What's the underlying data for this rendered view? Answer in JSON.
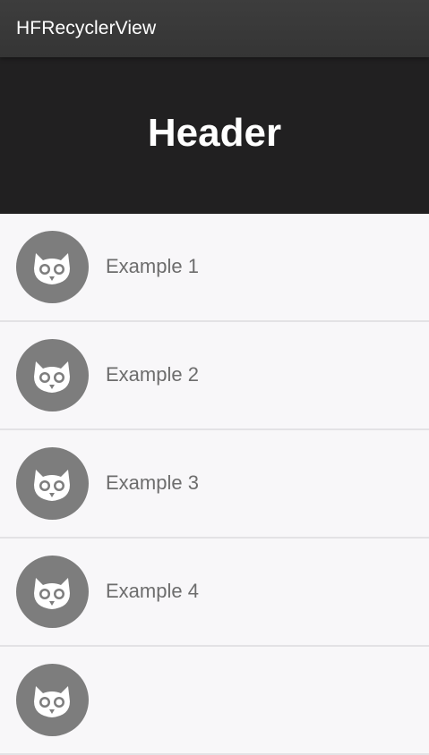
{
  "app_bar": {
    "title": "HFRecyclerView"
  },
  "header": {
    "text": "Header"
  },
  "list": {
    "items": [
      {
        "label": "Example 1",
        "icon": "owl-icon"
      },
      {
        "label": "Example 2",
        "icon": "owl-icon"
      },
      {
        "label": "Example 3",
        "icon": "owl-icon"
      },
      {
        "label": "Example 4",
        "icon": "owl-icon"
      },
      {
        "label": "",
        "icon": "owl-icon"
      }
    ]
  },
  "colors": {
    "app_bar": "#3a3a3a",
    "header_bg": "#212021",
    "list_bg": "#f8f7f9",
    "avatar_bg": "#7d7d7d",
    "item_text": "#6d6d6d"
  }
}
